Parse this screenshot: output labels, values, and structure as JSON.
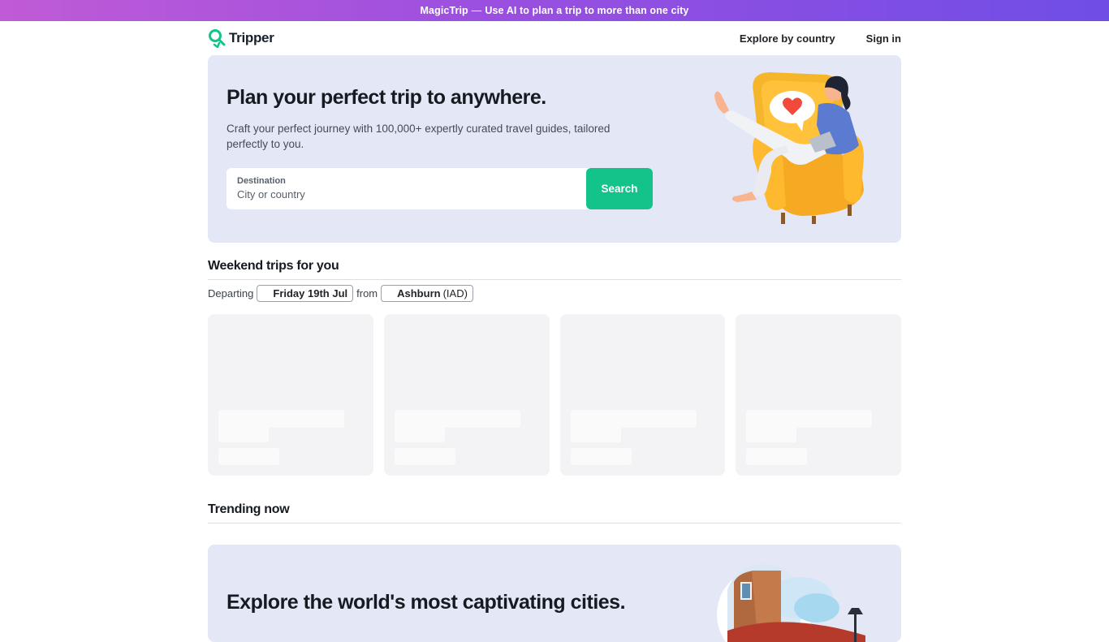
{
  "promo": {
    "brand": "MagicTrip",
    "dash": "—",
    "text": "Use AI to plan a trip to more than one city"
  },
  "header": {
    "logo_text": "Tripper",
    "nav": {
      "explore": "Explore by country",
      "sign_in": "Sign in"
    }
  },
  "hero": {
    "title": "Plan your perfect trip to anywhere.",
    "subtitle": "Craft your perfect journey with 100,000+ expertly curated travel guides, tailored perfectly to you.",
    "search": {
      "label": "Destination",
      "placeholder": "City or country",
      "button": "Search"
    }
  },
  "weekend": {
    "title": "Weekend trips for you",
    "departing_label": "Departing",
    "date": "Friday 19th Jul",
    "from_label": "from",
    "origin_city": "Ashburn",
    "origin_code": "(IAD)",
    "cards_loading": 4
  },
  "trending": {
    "title": "Trending now",
    "banner_title": "Explore the world's most captivating cities."
  },
  "colors": {
    "accent": "#13c38a",
    "hero_bg": "#e4e7f6",
    "promo_gradient_start": "#c05bd6",
    "promo_gradient_end": "#6f4ee6"
  }
}
